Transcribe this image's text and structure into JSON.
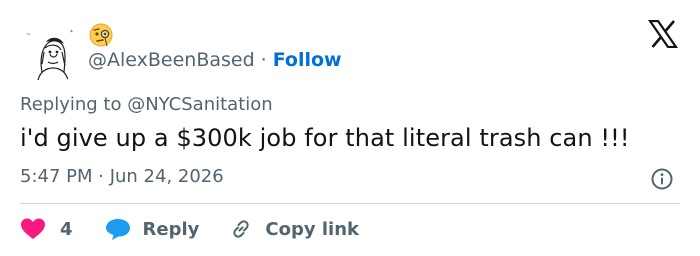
{
  "user": {
    "handle": "@AlexBeenBased",
    "separator": "·",
    "follow_label": "Follow",
    "name_emoji": "face-with-monocle-icon",
    "avatar": "sketch-portrait-avatar"
  },
  "reply_context": {
    "prefix": "Replying to ",
    "handle": "@NYCSanitation"
  },
  "tweet": {
    "text": "i'd give up a $300k job for that literal trash can !!!",
    "timestamp": "5:47 PM · Jun 24, 2026"
  },
  "actions": {
    "like_count": "4",
    "reply_label": "Reply",
    "copy_label": "Copy link"
  },
  "colors": {
    "link_blue": "#006fd6",
    "heart_pink": "#f91880",
    "reply_blue": "#1d9bf0",
    "muted": "#536471",
    "text": "#0f1419"
  },
  "icons": [
    "x-logo-icon",
    "info-icon",
    "heart-icon",
    "speech-bubble-icon",
    "link-icon"
  ]
}
